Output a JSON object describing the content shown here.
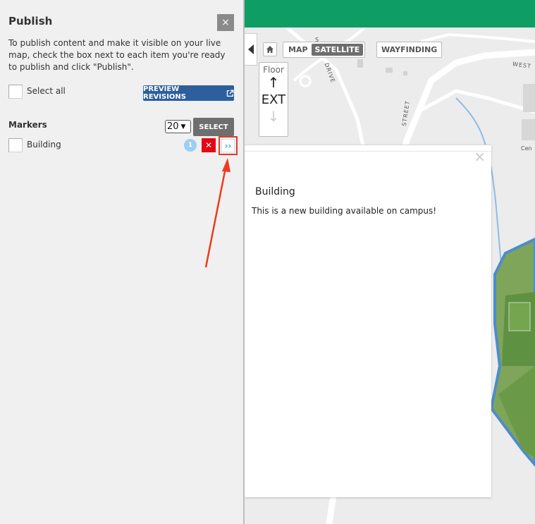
{
  "panel": {
    "title": "Publish",
    "close_label": "×",
    "description": "To publish content and make it visible on your live map, check the box next to each item you're ready to publish and click \"Publish\".",
    "select_all_label": "Select all",
    "preview_button_label": "PREVIEW REVISIONS",
    "markers": {
      "heading": "Markers",
      "per_page_value": "20",
      "select_button_label": "SELECT",
      "items": [
        {
          "label": "Building",
          "revision_count": "1",
          "delete_label": "✕",
          "move_label": "››"
        }
      ]
    }
  },
  "map": {
    "map_type_options": [
      "MAP",
      "SATELLITE"
    ],
    "active_map_type": "SATELLITE",
    "wayfinding_label": "WAYFINDING",
    "floor": {
      "label": "Floor",
      "up": "↑",
      "value": "EXT",
      "down": "↓"
    },
    "road_labels": [
      "WEST",
      "STREET",
      "DRIVE",
      "Cen"
    ],
    "popup": {
      "close_label": "×",
      "title": "Building",
      "body": "This is a new building available on campus!"
    }
  },
  "colors": {
    "topbar": "#0f9d66",
    "preview_button": "#2d5f9c",
    "delete_button": "#e30613",
    "badge": "#9ccef3",
    "highlight": "#e03a2b",
    "move_icon": "#39a9e0"
  },
  "icons": [
    "close-icon",
    "external-link-icon",
    "home-icon",
    "collapse-arrow-icon",
    "delete-icon",
    "move-icon",
    "up-arrow-icon",
    "down-arrow-icon"
  ]
}
